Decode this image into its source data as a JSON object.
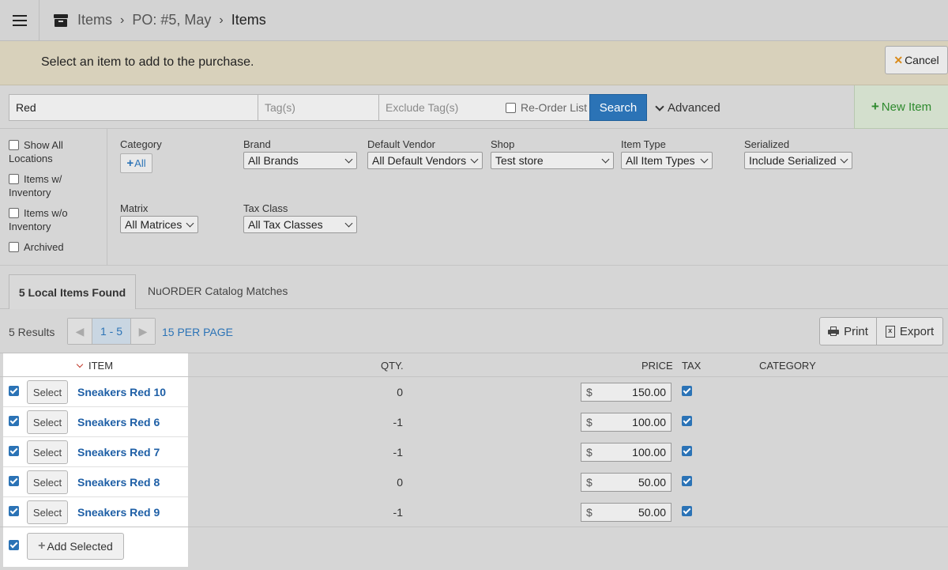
{
  "breadcrumb": [
    "Items",
    "PO: #5, May",
    "Items"
  ],
  "notice": {
    "text": "Select an item to add to the purchase.",
    "cancel_label": "Cancel"
  },
  "search": {
    "value": "Red",
    "tags_placeholder": "Tag(s)",
    "exclude_tags_placeholder": "Exclude Tag(s)",
    "reorder_label": "Re-Order List",
    "search_label": "Search",
    "advanced_label": "Advanced",
    "new_item_label": "New Item"
  },
  "locations": [
    {
      "label": "Show All Locations",
      "checked": false
    },
    {
      "label": "Items w/ Inventory",
      "checked": false
    },
    {
      "label": "Items w/o Inventory",
      "checked": false
    },
    {
      "label": "Archived",
      "checked": false
    }
  ],
  "filters": {
    "category": {
      "label": "Category",
      "button": "All"
    },
    "brand": {
      "label": "Brand",
      "value": "All Brands"
    },
    "vendor": {
      "label": "Default Vendor",
      "value": "All Default Vendors"
    },
    "shop": {
      "label": "Shop",
      "value": "Test store"
    },
    "item_type": {
      "label": "Item Type",
      "value": "All Item Types"
    },
    "serialized": {
      "label": "Serialized",
      "value": "Include Serialized"
    },
    "matrix": {
      "label": "Matrix",
      "value": "All Matrices"
    },
    "tax_class": {
      "label": "Tax Class",
      "value": "All Tax Classes"
    }
  },
  "tabs": [
    "5 Local Items Found",
    "NuORDER Catalog Matches"
  ],
  "results": {
    "count_label": "5 Results",
    "page_range": "1 - 5",
    "per_page": "15 PER PAGE",
    "print_label": "Print",
    "export_label": "Export"
  },
  "columns": {
    "item": "ITEM",
    "qty": "QTY.",
    "price": "PRICE",
    "tax": "TAX",
    "category": "CATEGORY"
  },
  "rows": [
    {
      "name": "Sneakers Red 10",
      "qty": "0",
      "currency": "$",
      "price": "150.00",
      "checked": true,
      "tax": true
    },
    {
      "name": "Sneakers Red 6",
      "qty": "-1",
      "currency": "$",
      "price": "100.00",
      "checked": true,
      "tax": true
    },
    {
      "name": "Sneakers Red 7",
      "qty": "-1",
      "currency": "$",
      "price": "100.00",
      "checked": true,
      "tax": true
    },
    {
      "name": "Sneakers Red 8",
      "qty": "0",
      "currency": "$",
      "price": "50.00",
      "checked": true,
      "tax": true
    },
    {
      "name": "Sneakers Red 9",
      "qty": "-1",
      "currency": "$",
      "price": "50.00",
      "checked": true,
      "tax": true
    }
  ],
  "row_select_label": "Select",
  "add_selected_label": "Add Selected",
  "colors": {
    "accent": "#2b73b6",
    "link": "#1e5fa6",
    "success": "#2e8a2e",
    "notice_bg": "#d8d1bb"
  }
}
